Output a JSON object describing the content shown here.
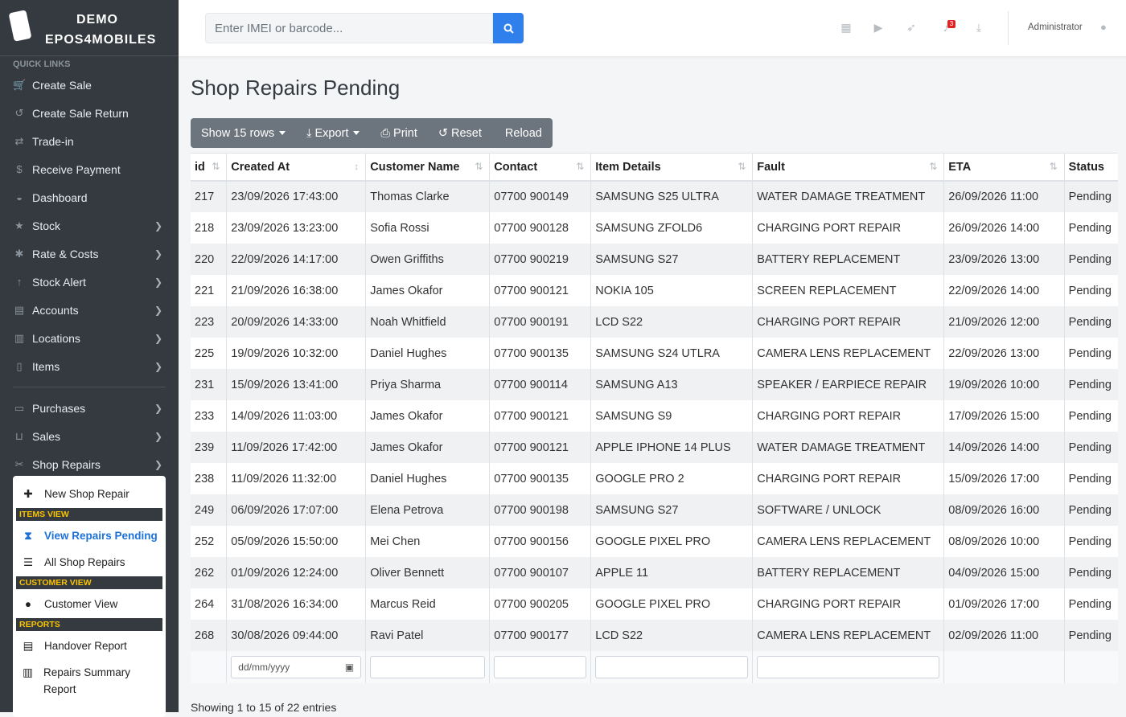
{
  "brand": {
    "line1": "DEMO",
    "line2": "EPOS4MOBILES"
  },
  "sidebar": {
    "quick_links_label": "QUICK LINKS",
    "items": [
      {
        "label": "Create Sale",
        "icon": "cart-icon",
        "chevron": false
      },
      {
        "label": "Create Sale Return",
        "icon": "undo-icon",
        "chevron": false
      },
      {
        "label": "Trade-in",
        "icon": "exchange-icon",
        "chevron": false
      },
      {
        "label": "Receive Payment",
        "icon": "dollar-icon",
        "chevron": false
      },
      {
        "label": "Dashboard",
        "icon": "dashboard-icon",
        "chevron": false
      },
      {
        "label": "Stock",
        "icon": "star-icon",
        "chevron": true
      },
      {
        "label": "Rate & Costs",
        "icon": "asterisk-icon",
        "chevron": true
      },
      {
        "label": "Stock Alert",
        "icon": "arrow-up-icon",
        "chevron": true
      },
      {
        "label": "Accounts",
        "icon": "ledger-icon",
        "chevron": true
      },
      {
        "label": "Locations",
        "icon": "map-icon",
        "chevron": true
      },
      {
        "label": "Items",
        "icon": "mobile-icon",
        "chevron": true
      },
      {
        "label": "Purchases",
        "icon": "hdd-icon",
        "chevron": true
      },
      {
        "label": "Sales",
        "icon": "basket-icon",
        "chevron": true
      },
      {
        "label": "Shop Repairs",
        "icon": "tools-icon",
        "chevron": true
      }
    ],
    "submenu": {
      "new_repair": "New Shop Repair",
      "items_view_head": "ITEMS VIEW",
      "view_pending": "View Repairs Pending",
      "all_repairs": "All Shop Repairs",
      "customer_view_head": "CUSTOMER VIEW",
      "customer_view": "Customer View",
      "reports_head": "REPORTS",
      "handover": "Handover Report",
      "summary": "Repairs Summary Report"
    }
  },
  "topbar": {
    "search_placeholder": "Enter IMEI or barcode...",
    "notification_count": "3",
    "user_name": "Administrator"
  },
  "page_title": "Shop Repairs Pending",
  "toolbar": {
    "show_rows": "Show 15 rows",
    "export": "Export",
    "print": "Print",
    "reset": "Reset",
    "reload": "Reload"
  },
  "table": {
    "columns": [
      "id",
      "Created At",
      "Customer Name",
      "Contact",
      "Item Details",
      "Fault",
      "ETA",
      "Status"
    ],
    "rows": [
      [
        "217",
        "23/09/2026 17:43:00",
        "Thomas Clarke",
        "07700 900149",
        "SAMSUNG S25 ULTRA",
        "WATER DAMAGE TREATMENT",
        "26/09/2026 11:00",
        "Pending"
      ],
      [
        "218",
        "23/09/2026 13:23:00",
        "Sofia Rossi",
        "07700 900128",
        "SAMSUNG ZFOLD6",
        "CHARGING PORT REPAIR",
        "26/09/2026 14:00",
        "Pending"
      ],
      [
        "220",
        "22/09/2026 14:17:00",
        "Owen Griffiths",
        "07700 900219",
        "SAMSUNG S27",
        "BATTERY REPLACEMENT",
        "23/09/2026 13:00",
        "Pending"
      ],
      [
        "221",
        "21/09/2026 16:38:00",
        "James Okafor",
        "07700 900121",
        "NOKIA 105",
        "SCREEN REPLACEMENT",
        "22/09/2026 14:00",
        "Pending"
      ],
      [
        "223",
        "20/09/2026 14:33:00",
        "Noah Whitfield",
        "07700 900191",
        "LCD S22",
        "CHARGING PORT REPAIR",
        "21/09/2026 12:00",
        "Pending"
      ],
      [
        "225",
        "19/09/2026 10:32:00",
        "Daniel Hughes",
        "07700 900135",
        "SAMSUNG S24 UTLRA",
        "CAMERA LENS REPLACEMENT",
        "22/09/2026 13:00",
        "Pending"
      ],
      [
        "231",
        "15/09/2026 13:41:00",
        "Priya Sharma",
        "07700 900114",
        "SAMSUNG A13",
        "SPEAKER / EARPIECE REPAIR",
        "19/09/2026 10:00",
        "Pending"
      ],
      [
        "233",
        "14/09/2026 11:03:00",
        "James Okafor",
        "07700 900121",
        "SAMSUNG S9",
        "CHARGING PORT REPAIR",
        "17/09/2026 15:00",
        "Pending"
      ],
      [
        "239",
        "11/09/2026 17:42:00",
        "James Okafor",
        "07700 900121",
        "APPLE IPHONE 14 PLUS",
        "WATER DAMAGE TREATMENT",
        "14/09/2026 14:00",
        "Pending"
      ],
      [
        "238",
        "11/09/2026 11:32:00",
        "Daniel Hughes",
        "07700 900135",
        "GOOGLE PRO 2",
        "CHARGING PORT REPAIR",
        "15/09/2026 17:00",
        "Pending"
      ],
      [
        "249",
        "06/09/2026 17:07:00",
        "Elena Petrova",
        "07700 900198",
        "SAMSUNG S27",
        "SOFTWARE / UNLOCK",
        "08/09/2026 16:00",
        "Pending"
      ],
      [
        "252",
        "05/09/2026 15:50:00",
        "Mei Chen",
        "07700 900156",
        "GOOGLE PIXEL PRO",
        "CAMERA LENS REPLACEMENT",
        "08/09/2026 10:00",
        "Pending"
      ],
      [
        "262",
        "01/09/2026 12:24:00",
        "Oliver Bennett",
        "07700 900107",
        "APPLE 11",
        "BATTERY REPLACEMENT",
        "04/09/2026 15:00",
        "Pending"
      ],
      [
        "264",
        "31/08/2026 16:34:00",
        "Marcus Reid",
        "07700 900205",
        "GOOGLE PIXEL PRO",
        "CHARGING PORT REPAIR",
        "01/09/2026 17:00",
        "Pending"
      ],
      [
        "268",
        "30/08/2026 09:44:00",
        "Ravi Patel",
        "07700 900177",
        "LCD S22",
        "CAMERA LENS REPLACEMENT",
        "02/09/2026 11:00",
        "Pending"
      ]
    ],
    "date_placeholder": "dd/mm/yyyy"
  },
  "footer_info": "Showing 1 to 15 of 22 entries"
}
